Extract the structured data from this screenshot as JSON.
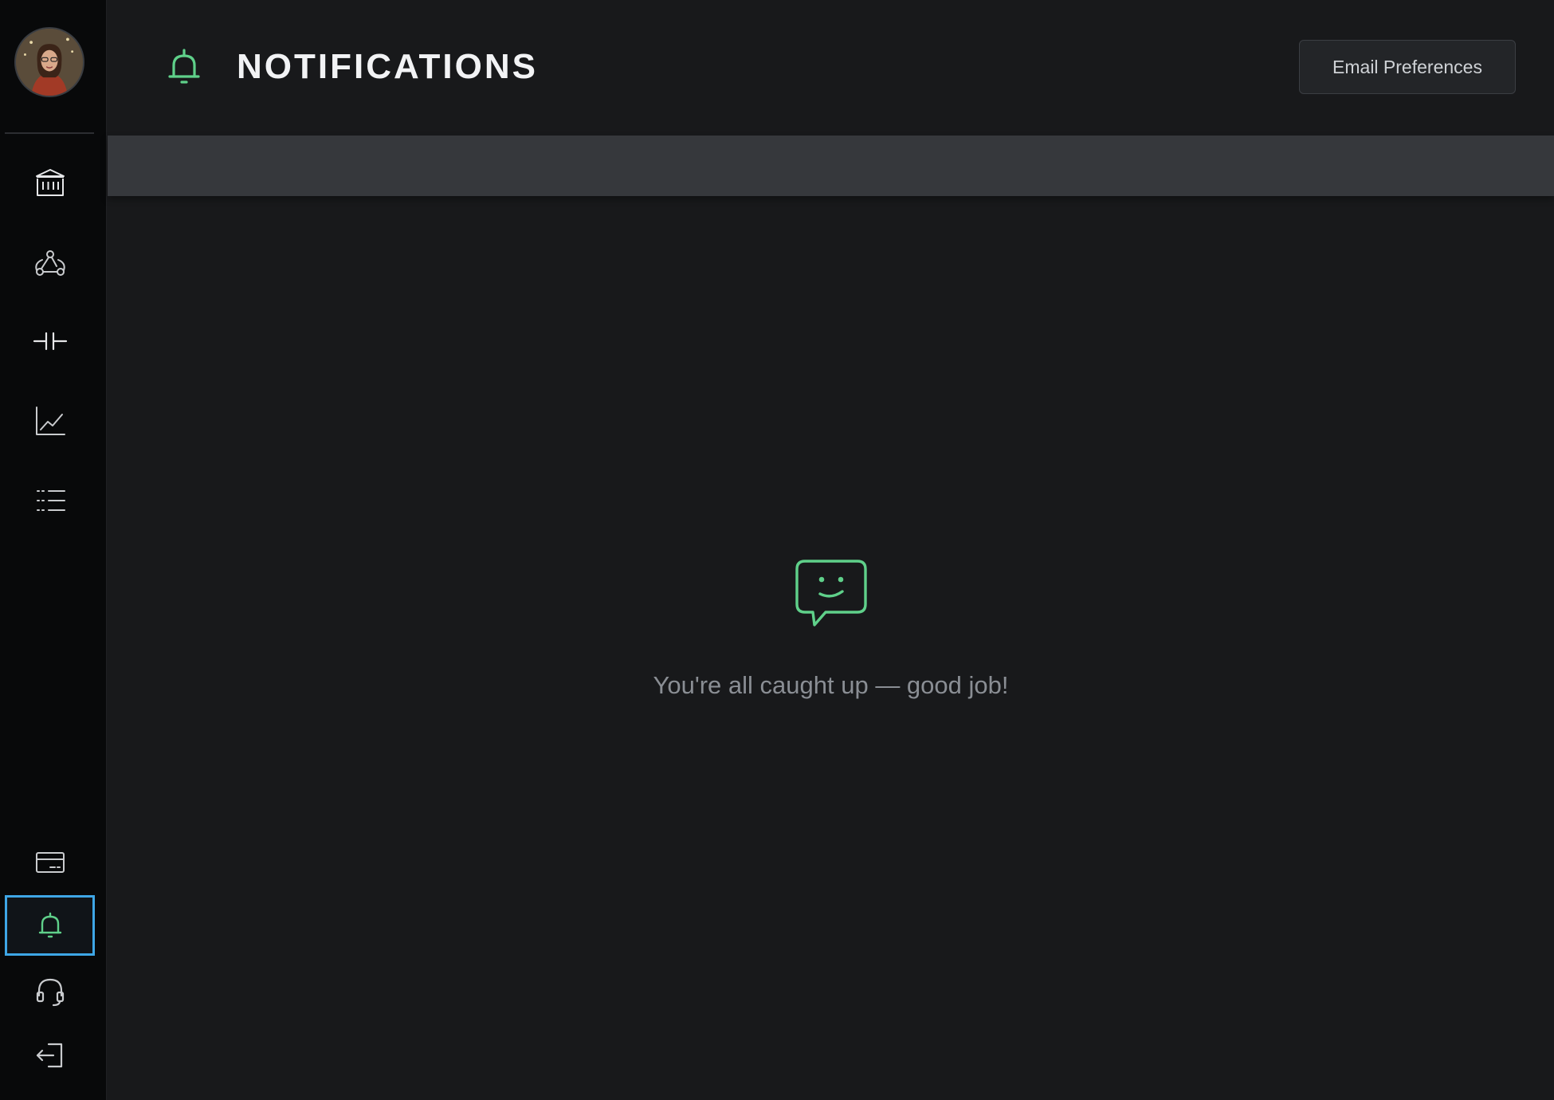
{
  "app": {
    "accent_color": "#5fd08a",
    "active_outline_color": "#3ea6e6"
  },
  "sidebar": {
    "avatar": {
      "icon": "user-avatar"
    },
    "top_items": [
      {
        "icon": "bank-icon"
      },
      {
        "icon": "webhook-icon"
      },
      {
        "icon": "split-icon"
      },
      {
        "icon": "chart-line-icon"
      },
      {
        "icon": "list-icon"
      }
    ],
    "bottom_items": [
      {
        "icon": "card-icon"
      },
      {
        "icon": "bell-icon",
        "active": true
      },
      {
        "icon": "headset-icon"
      },
      {
        "icon": "logout-icon"
      }
    ]
  },
  "header": {
    "title": "NOTIFICATIONS",
    "title_icon": "bell-icon",
    "email_preferences_label": "Email Preferences"
  },
  "empty_state": {
    "icon": "smile-chat-icon",
    "message": "You're all caught up — good job!"
  }
}
